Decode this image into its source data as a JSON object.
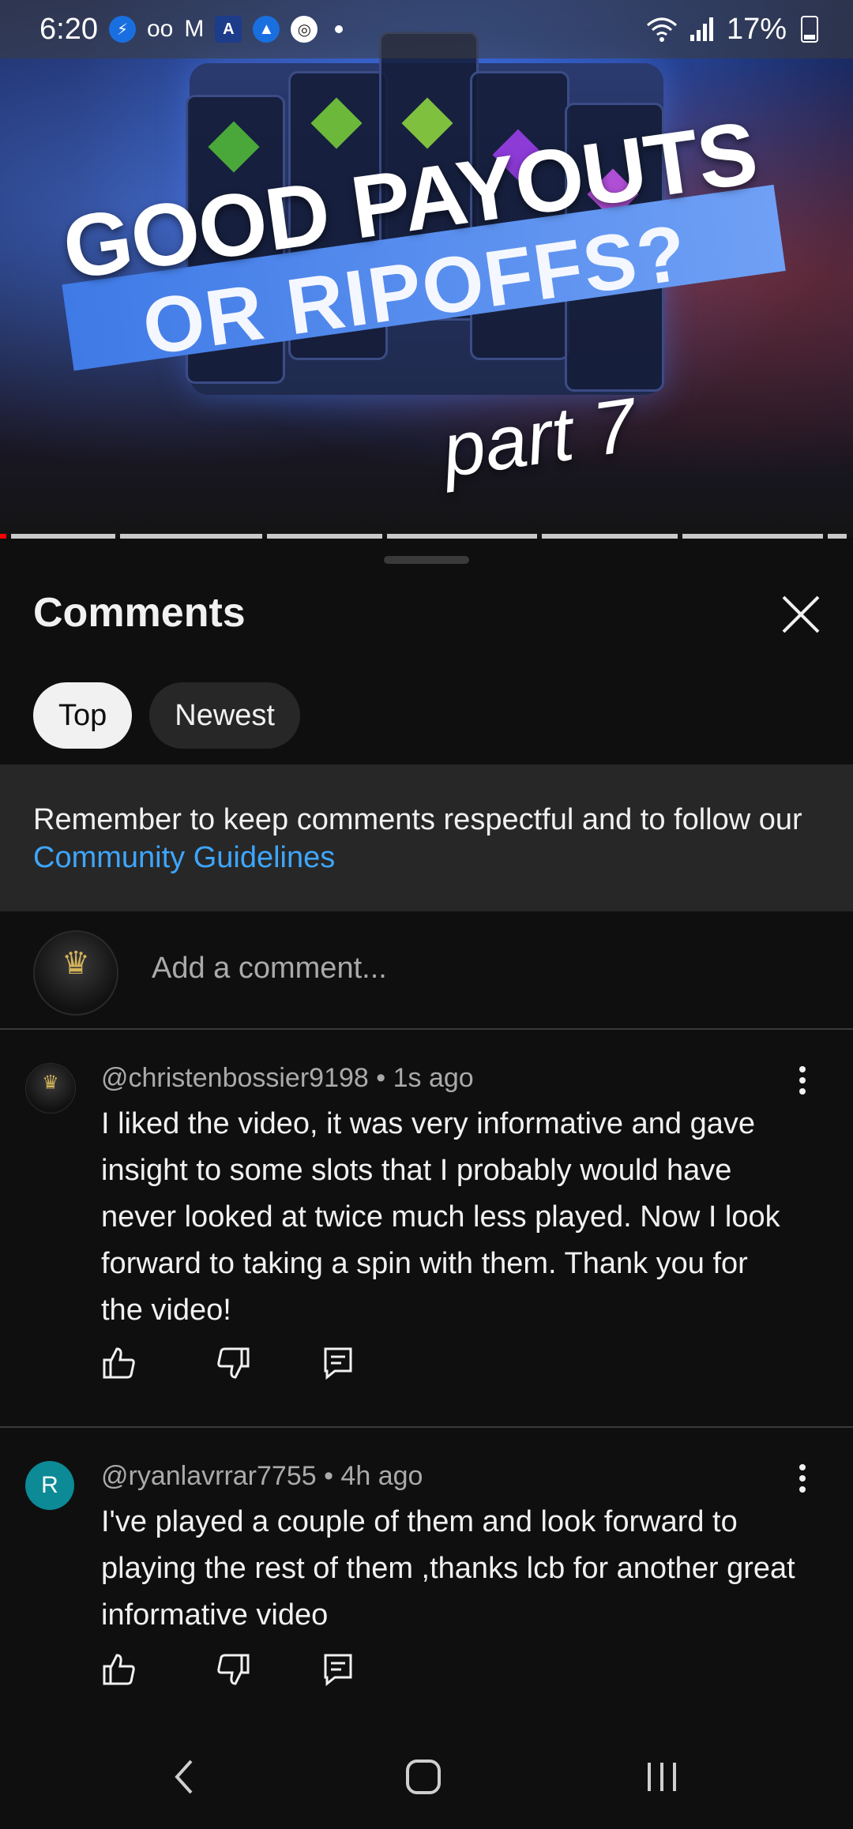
{
  "status_bar": {
    "time": "6:20",
    "battery": "17%",
    "notification_icons": [
      "messenger-icon",
      "voicemail-icon",
      "gmail-icon",
      "news-app-icon",
      "albertsons-icon",
      "sync-app-icon"
    ]
  },
  "video": {
    "title_line1": "GOOD PAYOUTS",
    "title_line2": "OR RIPOFFS?",
    "title_line3": "part 7",
    "chapter_segments": 7,
    "played_fraction": 0.01
  },
  "comments_panel": {
    "title": "Comments",
    "close_icon": "close-icon",
    "sort_chips": [
      {
        "label": "Top",
        "active": true
      },
      {
        "label": "Newest",
        "active": false
      }
    ],
    "notice_text": "Remember to keep comments respectful and to follow our ",
    "notice_link": "Community Guidelines",
    "add_comment_placeholder": "Add a comment...",
    "comments": [
      {
        "author": "@christenbossier9198",
        "age": "1s ago",
        "meta": "@christenbossier9198 • 1s ago",
        "text": "I liked the video, it was very informative and gave insight to some slots that I probably would have never looked at twice much less played.  Now I look forward to taking a spin with them.  Thank you for the video!",
        "avatar": "logo"
      },
      {
        "author": "@ryanlavrrar7755",
        "age": "4h ago",
        "meta": "@ryanlavrrar7755 • 4h ago",
        "text": "I've played a couple of them and look forward to playing the rest of them ,thanks lcb for another great informative video",
        "avatar": "R"
      }
    ]
  },
  "colors": {
    "background": "#0f0f0f",
    "link": "#3ea6ff",
    "notice_bg": "#272727",
    "progress_played": "#ff0000",
    "avatar_teal": "#0c8a96"
  }
}
